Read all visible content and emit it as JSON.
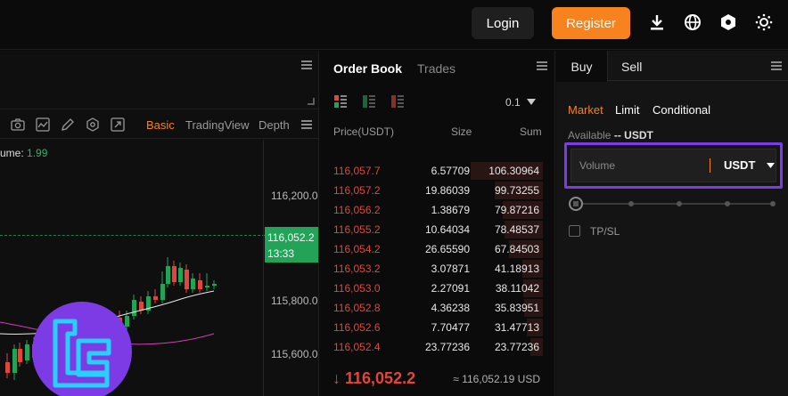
{
  "header": {
    "login_label": "Login",
    "register_label": "Register",
    "icons": [
      "download-icon",
      "globe-icon",
      "settings-hex-icon",
      "theme-sun-icon"
    ]
  },
  "chart": {
    "volume_prefix": "ume:",
    "volume_value": "1.99",
    "tabs": [
      "Basic",
      "TradingView",
      "Depth"
    ],
    "active_tab": "Basic",
    "price_ticks": [
      "116,200.0",
      "115,800.0",
      "115,600.0"
    ],
    "current_price": "116,052.2",
    "countdown": "13:33",
    "toolbar_icons": [
      "camera-icon",
      "line-chart-icon",
      "pencil-icon",
      "indicator-settings-icon",
      "expand-icon"
    ]
  },
  "orderbook": {
    "tabs": [
      "Order Book",
      "Trades"
    ],
    "precision": "0.1",
    "columns": {
      "price": "Price(USDT)",
      "size": "Size",
      "sum": "Sum"
    },
    "asks": [
      {
        "price": "116,057.7",
        "size": "6.57709",
        "sum": "106.30964",
        "depth": 0.9
      },
      {
        "price": "116,057.2",
        "size": "19.86039",
        "sum": "99.73255",
        "depth": 0.6
      },
      {
        "price": "116,056.2",
        "size": "1.38679",
        "sum": "79.87216",
        "depth": 0.5
      },
      {
        "price": "116,055.2",
        "size": "10.64034",
        "sum": "78.48537",
        "depth": 0.48
      },
      {
        "price": "116,054.2",
        "size": "26.65590",
        "sum": "67.84503",
        "depth": 0.42
      },
      {
        "price": "116,053.2",
        "size": "3.07871",
        "sum": "41.18913",
        "depth": 0.26
      },
      {
        "price": "116,053.0",
        "size": "2.27091",
        "sum": "38.11042",
        "depth": 0.24
      },
      {
        "price": "116,052.8",
        "size": "4.36238",
        "sum": "35.83951",
        "depth": 0.23
      },
      {
        "price": "116,052.6",
        "size": "7.70477",
        "sum": "31.47713",
        "depth": 0.2
      },
      {
        "price": "116,052.4",
        "size": "23.77236",
        "sum": "23.77236",
        "depth": 0.15
      }
    ],
    "last_price": "↓ 116,052.2",
    "index_price": "≈ 116,052.19 USD"
  },
  "trade": {
    "tabs": [
      "Buy",
      "Sell"
    ],
    "order_types": [
      "Market",
      "Limit",
      "Conditional"
    ],
    "active_order_type": "Market",
    "available_label": "Available",
    "available_value": "-- USDT",
    "volume_placeholder": "Volume",
    "volume_unit": "USDT",
    "tpsl_label": "TP/SL",
    "colors": {
      "accent": "#f7821e",
      "highlight": "#7b3be6",
      "up": "#22a358",
      "down": "#e0463b"
    }
  }
}
